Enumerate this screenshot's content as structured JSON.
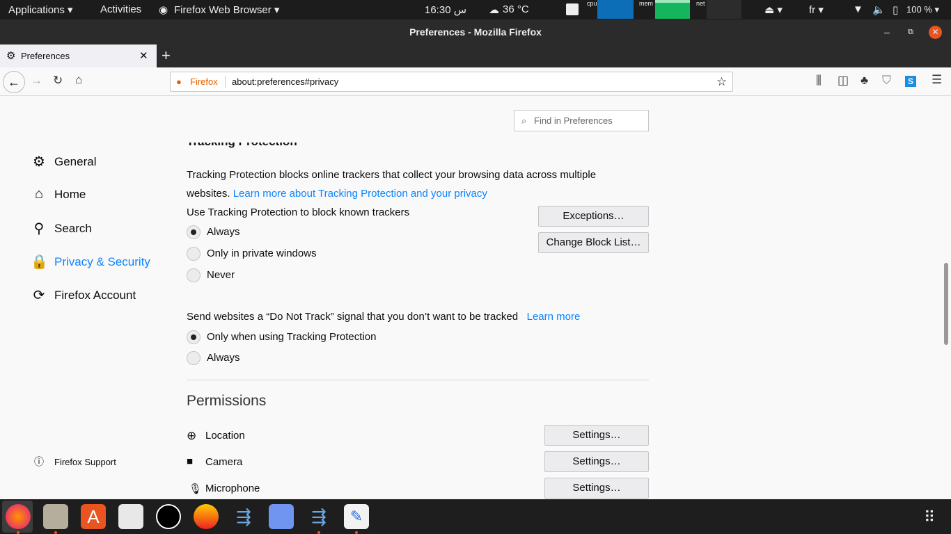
{
  "topbar": {
    "applications": "Applications ▾",
    "activities": "Activities",
    "app_name": "Firefox Web Browser ▾",
    "clock": "16:30 س",
    "weather": "36 °C",
    "cpu": "cpu",
    "mem": "mem",
    "net": "net",
    "lang": "fr ▾",
    "battery": "100 % ▾"
  },
  "window": {
    "title": "Preferences - Mozilla Firefox"
  },
  "tab": {
    "label": "Preferences"
  },
  "urlbar": {
    "identity": "Firefox",
    "url": "about:preferences#privacy"
  },
  "search": {
    "placeholder": "Find in Preferences"
  },
  "sidebar": {
    "items": [
      {
        "label": "General"
      },
      {
        "label": "Home"
      },
      {
        "label": "Search"
      },
      {
        "label": "Privacy & Security"
      },
      {
        "label": "Firefox Account"
      }
    ],
    "support": "Firefox Support"
  },
  "tracking": {
    "heading": "Tracking Protection",
    "desc": "Tracking Protection blocks online trackers that collect your browsing data across multiple",
    "desc2": "websites.",
    "learn_link": "Learn more about Tracking Protection and your privacy",
    "use_label": "Use Tracking Protection to block known trackers",
    "options": [
      "Always",
      "Only in private windows",
      "Never"
    ],
    "selected": "Always",
    "exceptions": "Exceptions…",
    "change_block": "Change Block List…"
  },
  "dnt": {
    "label": "Send websites a “Do Not Track” signal that you don’t want to be tracked",
    "learn": "Learn more",
    "options": [
      "Only when using Tracking Protection",
      "Always"
    ],
    "selected": "Only when using Tracking Protection"
  },
  "permissions": {
    "heading": "Permissions",
    "items": [
      {
        "label": "Location",
        "button": "Settings…"
      },
      {
        "label": "Camera",
        "button": "Settings…"
      },
      {
        "label": "Microphone",
        "button": "Settings…"
      }
    ]
  },
  "colors": {
    "accent": "#0a84ff",
    "topbar": "#1c1c1c",
    "dock": "#1e1e1e"
  }
}
